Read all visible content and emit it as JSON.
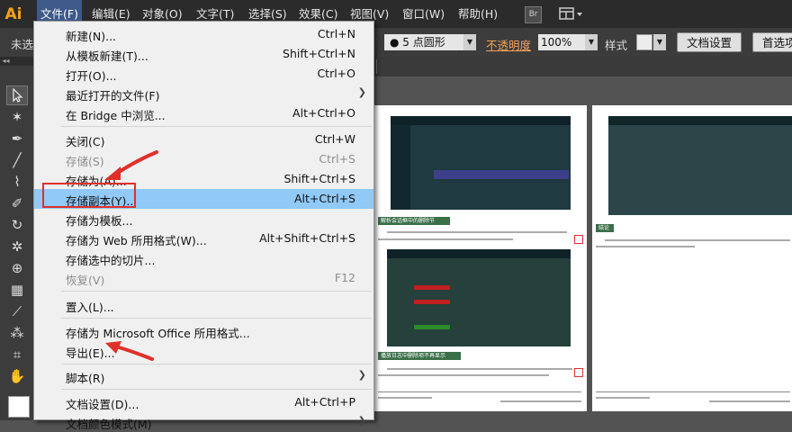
{
  "app": {
    "logo": "Ai"
  },
  "menubar": {
    "items": [
      "文件(F)",
      "编辑(E)",
      "对象(O)",
      "文字(T)",
      "选择(S)",
      "效果(C)",
      "视图(V)",
      "窗口(W)",
      "帮助(H)"
    ],
    "bridge_label": "Br"
  },
  "control_bar": {
    "selection_label": "未选",
    "stroke_value": "5 点圆形",
    "opacity_label": "不透明度",
    "opacity_value": "100%",
    "style_label": "样式",
    "doc_settings_label": "文档设置",
    "prefs_label": "首选项"
  },
  "file_menu": {
    "items": [
      {
        "label": "新建(N)...",
        "shortcut": "Ctrl+N",
        "enabled": true
      },
      {
        "label": "从模板新建(T)...",
        "shortcut": "Shift+Ctrl+N",
        "enabled": true
      },
      {
        "label": "打开(O)...",
        "shortcut": "Ctrl+O",
        "enabled": true
      },
      {
        "label": "最近打开的文件(F)",
        "shortcut": "",
        "enabled": true,
        "submenu": true
      },
      {
        "label": "在 Bridge 中浏览...",
        "shortcut": "Alt+Ctrl+O",
        "enabled": true
      },
      {
        "label": "关闭(C)",
        "shortcut": "Ctrl+W",
        "enabled": true
      },
      {
        "label": "存储(S)",
        "shortcut": "Ctrl+S",
        "enabled": false
      },
      {
        "label": "存储为(A)...",
        "shortcut": "Shift+Ctrl+S",
        "enabled": true
      },
      {
        "label": "存储副本(Y)...",
        "shortcut": "Alt+Ctrl+S",
        "enabled": true,
        "highlighted": true
      },
      {
        "label": "存储为模板...",
        "shortcut": "",
        "enabled": true
      },
      {
        "label": "存储为 Web 所用格式(W)...",
        "shortcut": "Alt+Shift+Ctrl+S",
        "enabled": true
      },
      {
        "label": "存储选中的切片...",
        "shortcut": "",
        "enabled": true
      },
      {
        "label": "恢复(V)",
        "shortcut": "F12",
        "enabled": false
      },
      {
        "label": "置入(L)...",
        "shortcut": "",
        "enabled": true
      },
      {
        "label": "存储为 Microsoft Office 所用格式...",
        "shortcut": "",
        "enabled": true
      },
      {
        "label": "导出(E)...",
        "shortcut": "",
        "enabled": true
      },
      {
        "label": "脚本(R)",
        "shortcut": "",
        "enabled": true,
        "submenu": true
      },
      {
        "label": "文档设置(D)...",
        "shortcut": "Alt+Ctrl+P",
        "enabled": true
      },
      {
        "label": "文档颜色模式(M)",
        "shortcut": "",
        "enabled": true,
        "submenu": true
      }
    ]
  },
  "document": {
    "page1": {
      "section1": "解析会话框中的删除节",
      "section2": "播放日志中删除项不再显示"
    },
    "page2": {
      "section1": "结论"
    }
  },
  "colors": {
    "menubar": "#2b2b2b",
    "menu_highlight": "#91c9f7",
    "annotation_red": "#e0302a",
    "opacity_label": "#f0a25a"
  }
}
